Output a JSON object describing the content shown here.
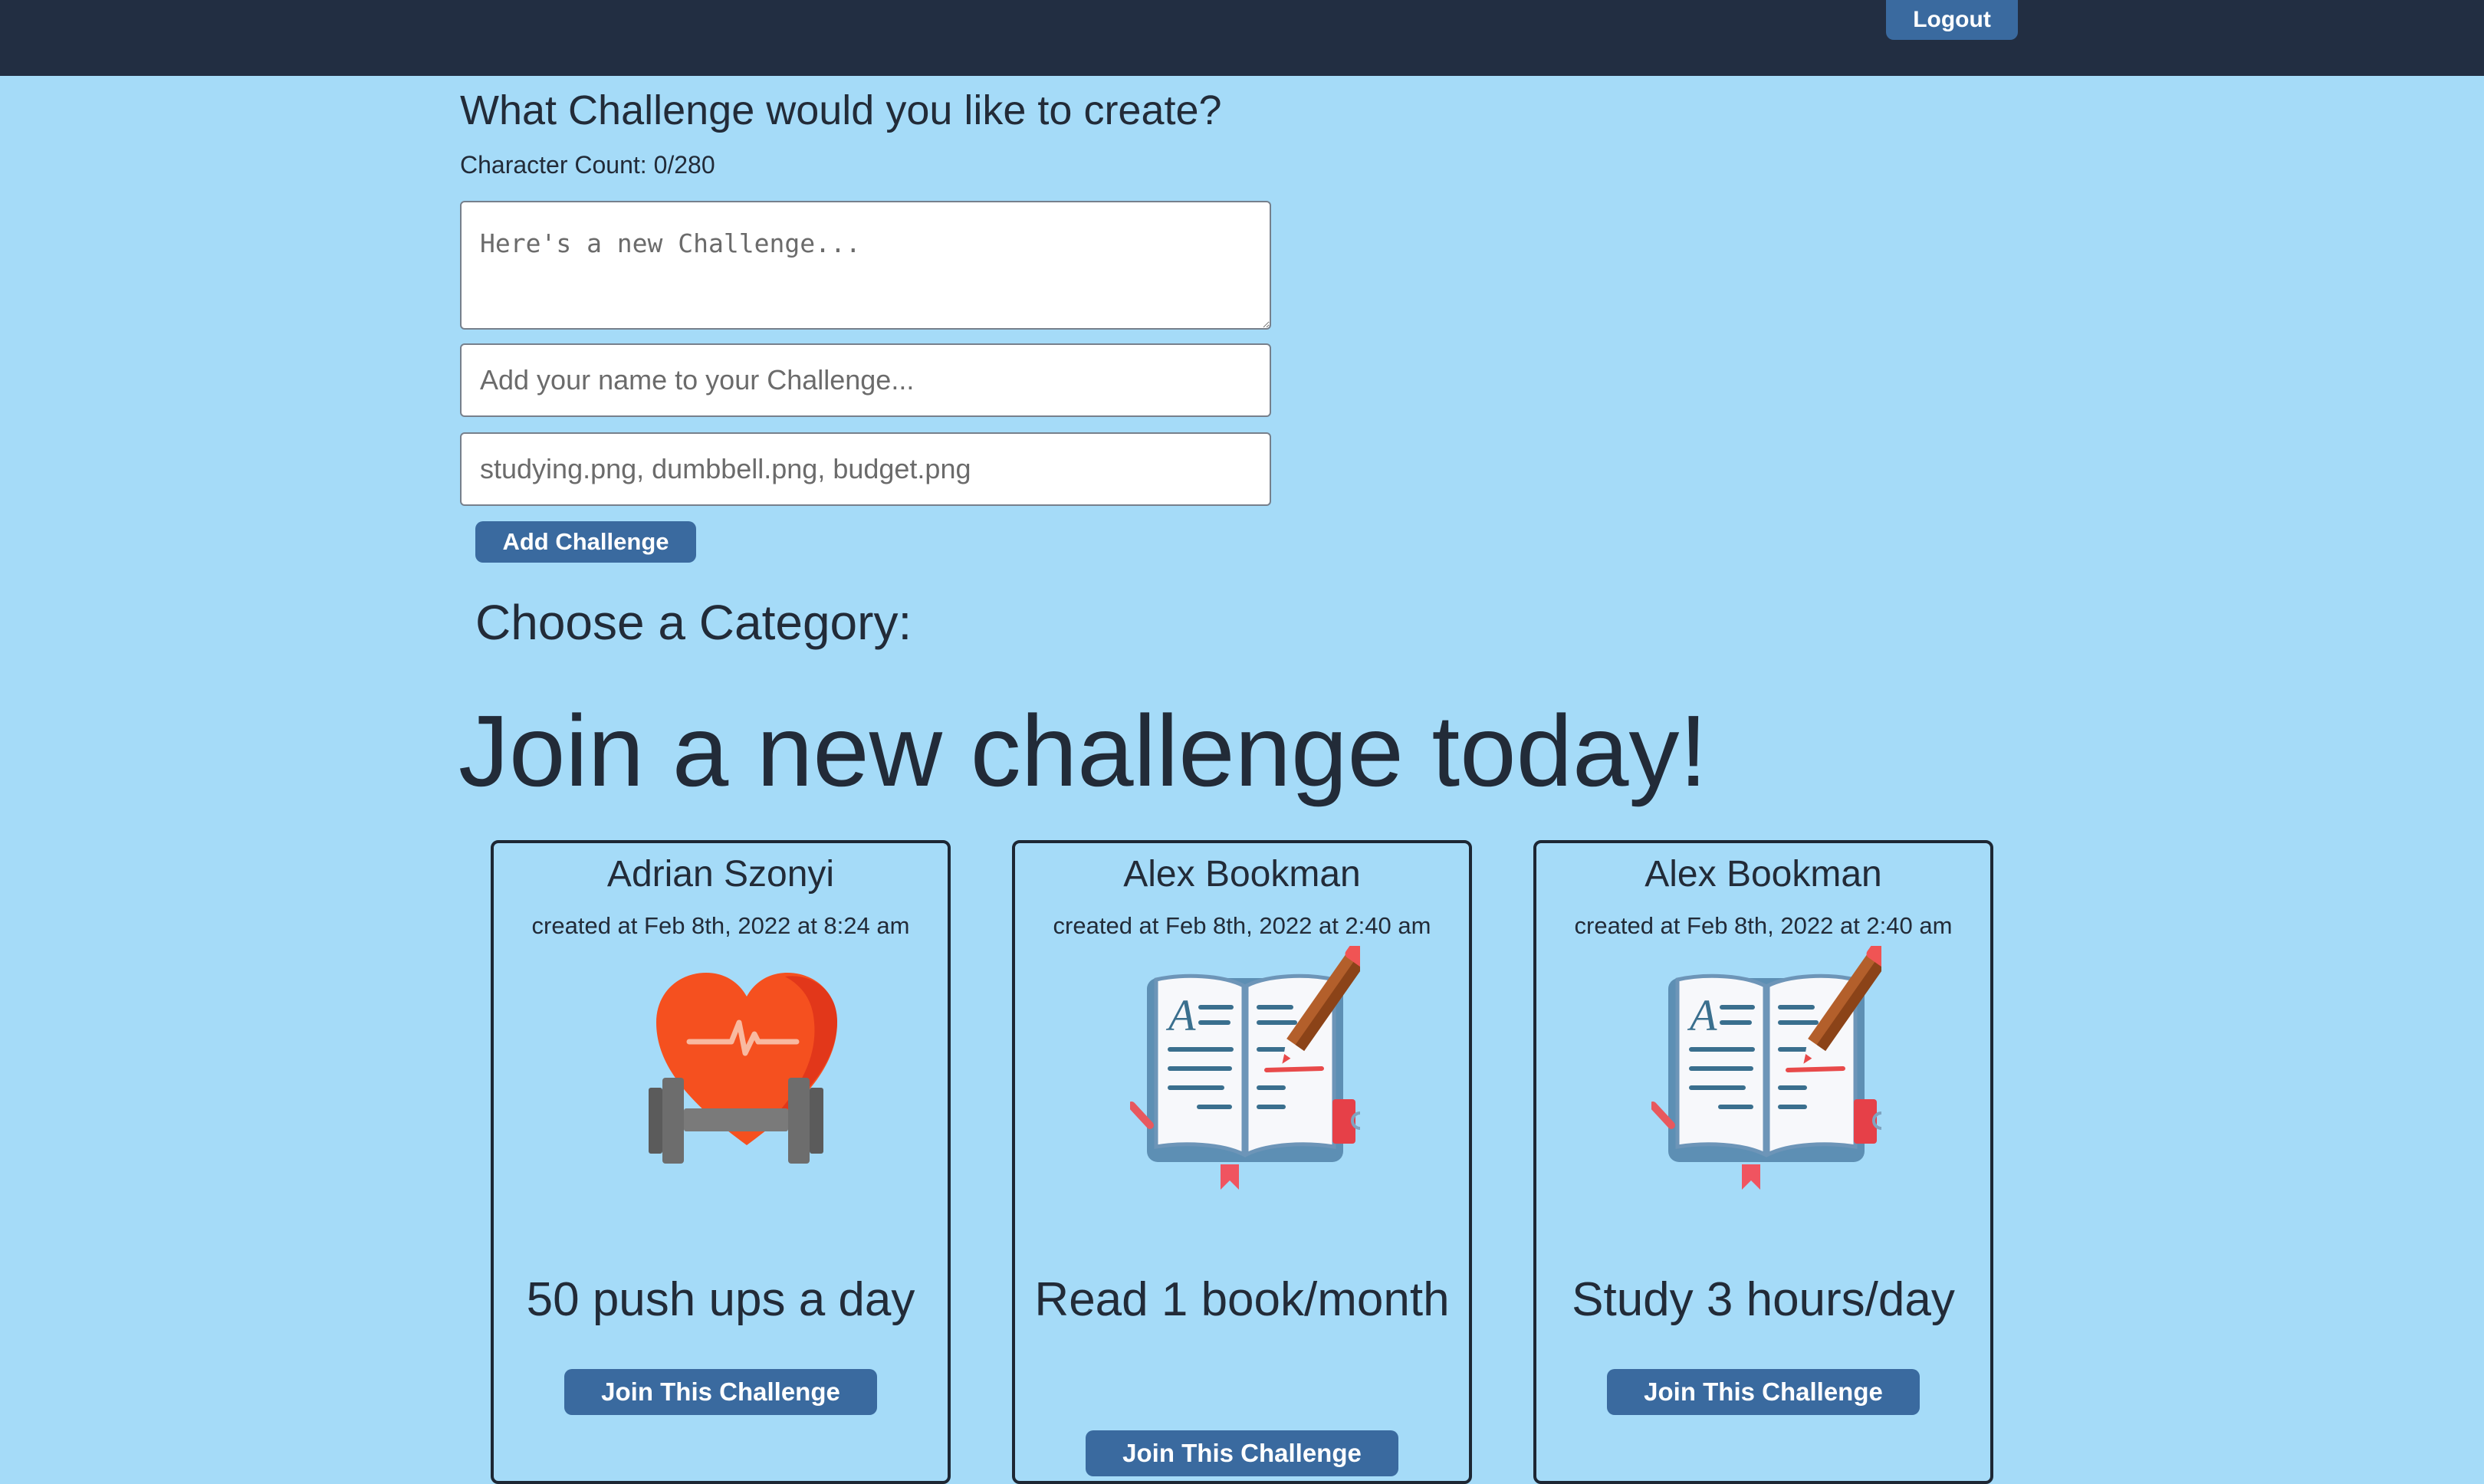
{
  "header": {
    "logout_label": "Logout"
  },
  "create_form": {
    "title": "What Challenge would you like to create?",
    "character_count": "Character Count: 0/280",
    "challenge_placeholder": "Here's a new Challenge...",
    "name_placeholder": "Add your name to your Challenge...",
    "image_placeholder": "studying.png, dumbbell.png, budget.png",
    "submit_label": "Add Challenge"
  },
  "category_label": "Choose a Category:",
  "join_heading": "Join a new challenge today!",
  "cards": [
    {
      "author": "Adrian Szonyi",
      "created": "created at Feb 8th, 2022 at 8:24 am",
      "image": "heart-dumbbell",
      "title": "50 push ups a day",
      "button": "Join This Challenge"
    },
    {
      "author": "Alex Bookman",
      "created": "created at Feb 8th, 2022 at 2:40 am",
      "image": "open-book",
      "title": "Read 1 book/month",
      "button": "Join This Challenge"
    },
    {
      "author": "Alex Bookman",
      "created": "created at Feb 8th, 2022 at 2:40 am",
      "image": "open-book",
      "title": "Study 3 hours/day",
      "button": "Join This Challenge"
    }
  ],
  "colors": {
    "page_bg": "#a5dbf8",
    "topbar_bg": "#222e42",
    "button_bg": "#3a6a9f",
    "text": "#222b38"
  }
}
